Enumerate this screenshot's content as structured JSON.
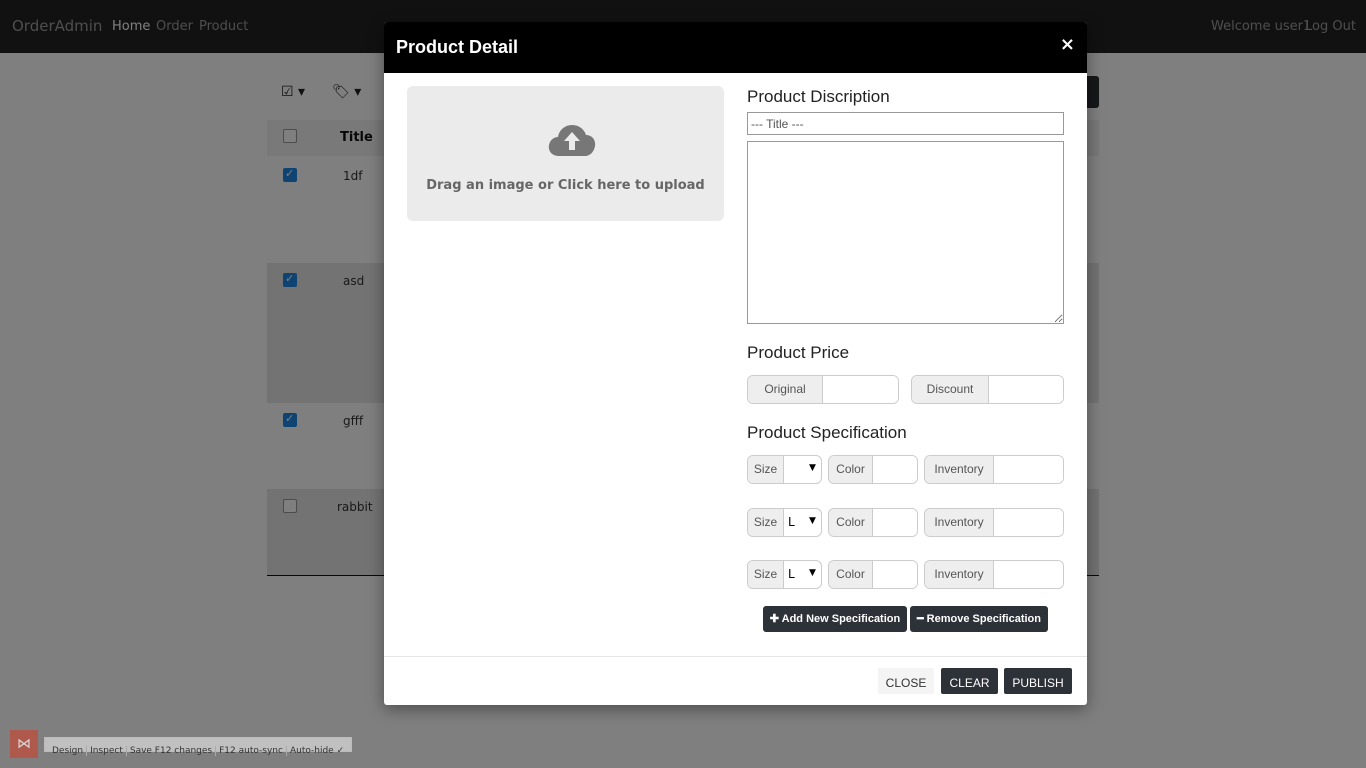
{
  "navbar": {
    "brand": "OrderAdmin",
    "links": [
      "Home",
      "Order",
      "Product"
    ],
    "welcome": "Welcome user1",
    "logout": "Log Out"
  },
  "table": {
    "header_title": "Title",
    "rows": [
      {
        "title": "1df",
        "checked": true
      },
      {
        "title": "asd",
        "checked": true
      },
      {
        "title": "gfff",
        "checked": true
      },
      {
        "title": "rabbit",
        "checked": false
      }
    ]
  },
  "modal": {
    "title": "Product Detail",
    "close_glyph": "×",
    "upload_text": "Drag an image or Click here to upload",
    "description_heading": "Product Discription",
    "title_placeholder": "--- Title ---",
    "price_heading": "Product Price",
    "original_label": "Original",
    "discount_label": "Discount",
    "spec_heading": "Product Specification",
    "specs": [
      {
        "size_label": "Size",
        "size_value": "",
        "color_label": "Color",
        "inventory_label": "Inventory"
      },
      {
        "size_label": "Size",
        "size_value": "L",
        "color_label": "Color",
        "inventory_label": "Inventory"
      },
      {
        "size_label": "Size",
        "size_value": "L",
        "color_label": "Color",
        "inventory_label": "Inventory"
      }
    ],
    "add_spec_label": "Add New Specification",
    "remove_spec_label": "Remove Specification",
    "footer": {
      "close": "CLOSE",
      "clear": "CLEAR",
      "publish": "PUBLISH"
    }
  },
  "devtools": {
    "items": [
      "Design",
      "Inspect",
      "Save F12 changes",
      "F12 auto-sync",
      "Auto-hide ✓"
    ]
  }
}
